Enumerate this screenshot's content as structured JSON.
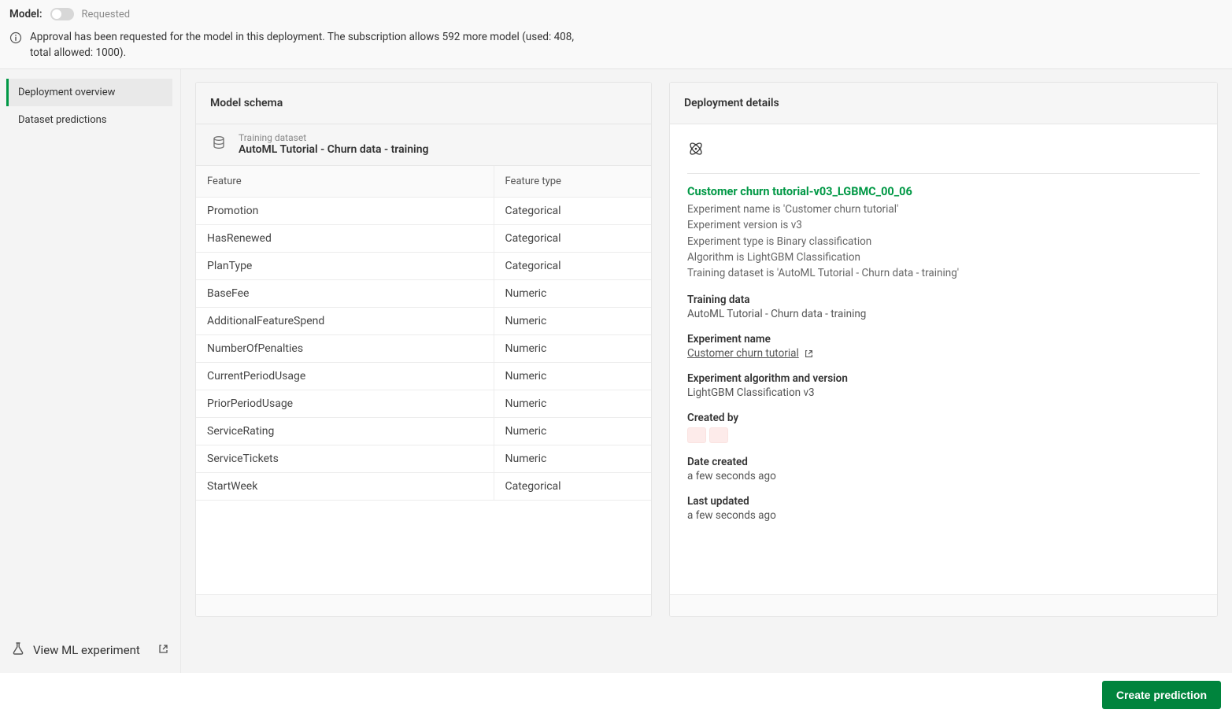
{
  "topbar": {
    "model_label": "Model:",
    "status_text": "Requested",
    "info_text": "Approval has been requested for the model in this deployment. The subscription allows 592 more model (used: 408, total allowed: 1000)."
  },
  "sidebar": {
    "items": [
      {
        "label": "Deployment overview",
        "active": true
      },
      {
        "label": "Dataset predictions",
        "active": false
      }
    ],
    "view_ml_label": "View ML experiment"
  },
  "schema_panel": {
    "title": "Model schema",
    "training_dataset_label": "Training dataset",
    "training_dataset_name": "AutoML Tutorial - Churn data - training",
    "columns": {
      "feature": "Feature",
      "feature_type": "Feature type"
    },
    "rows": [
      {
        "feature": "Promotion",
        "type": "Categorical"
      },
      {
        "feature": "HasRenewed",
        "type": "Categorical"
      },
      {
        "feature": "PlanType",
        "type": "Categorical"
      },
      {
        "feature": "BaseFee",
        "type": "Numeric"
      },
      {
        "feature": "AdditionalFeatureSpend",
        "type": "Numeric"
      },
      {
        "feature": "NumberOfPenalties",
        "type": "Numeric"
      },
      {
        "feature": "CurrentPeriodUsage",
        "type": "Numeric"
      },
      {
        "feature": "PriorPeriodUsage",
        "type": "Numeric"
      },
      {
        "feature": "ServiceRating",
        "type": "Numeric"
      },
      {
        "feature": "ServiceTickets",
        "type": "Numeric"
      },
      {
        "feature": "StartWeek",
        "type": "Categorical"
      }
    ]
  },
  "details_panel": {
    "title": "Deployment details",
    "model_title": "Customer churn tutorial-v03_LGBMC_00_06",
    "facts": [
      "Experiment name is 'Customer churn tutorial'",
      "Experiment version is v3",
      "Experiment type is Binary classification",
      "Algorithm is LightGBM Classification",
      "Training dataset is 'AutoML Tutorial - Churn data - training'"
    ],
    "kv": [
      {
        "k": "Training data",
        "v": "AutoML Tutorial - Churn data - training",
        "link": false
      },
      {
        "k": "Experiment name",
        "v": "Customer churn tutorial",
        "link": true
      },
      {
        "k": "Experiment algorithm and version",
        "v": "LightGBM Classification v3",
        "link": false
      },
      {
        "k": "Created by",
        "v": "",
        "avatars": 2
      },
      {
        "k": "Date created",
        "v": "a few seconds ago"
      },
      {
        "k": "Last updated",
        "v": "a few seconds ago"
      }
    ]
  },
  "action_bar": {
    "create_prediction_label": "Create prediction"
  }
}
